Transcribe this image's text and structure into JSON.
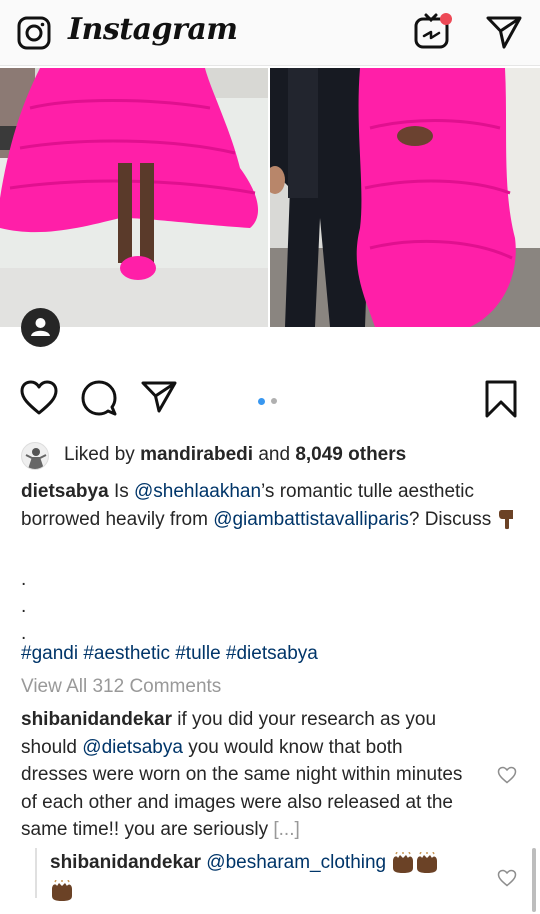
{
  "app": {
    "name": "Instagram"
  },
  "post": {
    "carousel": {
      "count": 2,
      "active_index": 0
    },
    "likes": {
      "liker": "mandirabedi",
      "connector": "and",
      "others": "8,049 others",
      "prefix": "Liked by"
    },
    "caption": {
      "author": "dietsabya",
      "text1": "Is",
      "mention1": "@shehlaakhan",
      "text2": "’s romantic tulle aesthetic borrowed heavily from",
      "mention2": "@giambattistavalliparis",
      "text3": "? Discuss",
      "dots": [
        ".",
        ".",
        "."
      ],
      "hashtags": "#gandi #aesthetic #tulle #dietsabya"
    },
    "view_all_comments": "View All 312 Comments",
    "comments": [
      {
        "author": "shibanidandekar",
        "text1": "if you did your research as you should",
        "mention": "@dietsabya",
        "text2": "you would know that both dresses were worn on the same night within minutes of each other and images were also released at the same time!! you are seriously",
        "more": "[...]"
      }
    ],
    "reply": {
      "author": "shibanidandekar",
      "mention": "@besharam_clothing"
    }
  },
  "colors": {
    "accent_dot": "#3897f0",
    "link": "#003569",
    "notification": "#ed4956",
    "dress_pink": "#ff1fa8"
  },
  "icons": [
    "camera-icon",
    "igtv-icon",
    "direct-icon",
    "heart-icon",
    "comment-icon",
    "share-icon",
    "bookmark-icon",
    "user-tag-icon",
    "clap-emoji-icon",
    "point-down-emoji-icon"
  ]
}
